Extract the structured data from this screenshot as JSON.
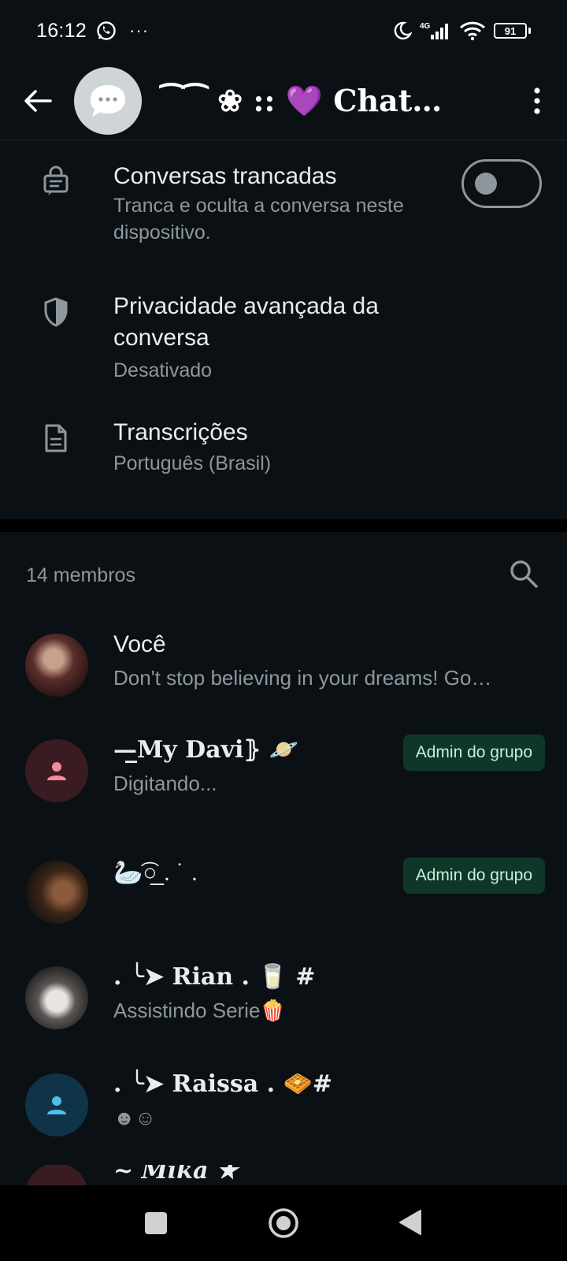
{
  "status_bar": {
    "time": "16:12",
    "more": "···",
    "network": "4G",
    "battery": "91"
  },
  "header": {
    "title": "⁀⁀ ❀ :: 💜 Chat…"
  },
  "settings": [
    {
      "title": "Conversas trancadas",
      "subtitle": "Tranca e oculta a conversa neste dispositivo.",
      "toggle": false
    },
    {
      "title": "Privacidade avançada da conversa",
      "subtitle": "Desativado"
    },
    {
      "title": "Transcrições",
      "subtitle": "Português (Brasil)"
    }
  ],
  "members": {
    "count_label": "14 membros",
    "list": [
      {
        "name": "Você",
        "status": "Don't stop believing in your dreams! Go…",
        "badge": ""
      },
      {
        "name": "—̲My Davi⦄  🪐",
        "status": "Digitando...",
        "badge": "Admin do grupo"
      },
      {
        "name": "🦢͡○̲ .   ˙  .",
        "status": "",
        "badge": "Admin do grupo"
      },
      {
        "name": ". ╰➤ Rian . 🥛 #",
        "status": "Assistindo Serie🍿",
        "badge": ""
      },
      {
        "name": ". ╰➤ Raissa . 🧇#",
        "status": "☻☺",
        "badge": ""
      },
      {
        "name": "~ Mika ★",
        "status": "",
        "badge": ""
      }
    ]
  },
  "colors": {
    "background": "#0b1014",
    "admin_badge_bg": "#103529",
    "admin_badge_text": "#c8f0d8",
    "secondary_text": "#8d979d"
  }
}
